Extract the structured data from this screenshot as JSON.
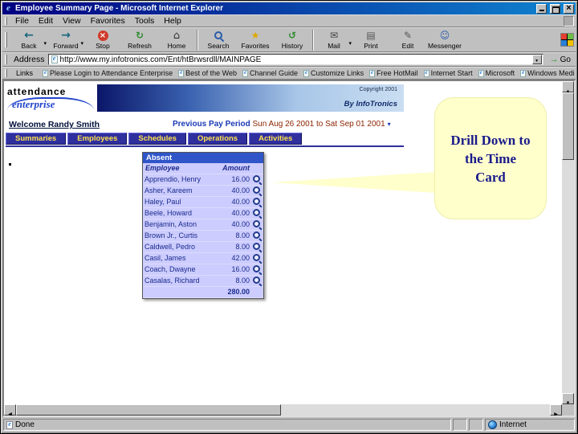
{
  "window": {
    "title": "Employee Summary Page - Microsoft Internet Explorer"
  },
  "menubar": {
    "items": [
      "File",
      "Edit",
      "View",
      "Favorites",
      "Tools",
      "Help"
    ]
  },
  "toolbar": {
    "buttons": [
      {
        "label": "Back",
        "icon": "back-icon",
        "has_menu": true
      },
      {
        "label": "Forward",
        "icon": "forward-icon",
        "has_menu": true
      },
      {
        "label": "Stop",
        "icon": "stop-icon"
      },
      {
        "label": "Refresh",
        "icon": "refresh-icon"
      },
      {
        "label": "Home",
        "icon": "home-icon",
        "sep_after": true
      },
      {
        "label": "Search",
        "icon": "search-icon"
      },
      {
        "label": "Favorites",
        "icon": "favorites-icon"
      },
      {
        "label": "History",
        "icon": "history-icon",
        "sep_after": true
      },
      {
        "label": "Mail",
        "icon": "mail-icon",
        "has_menu": true
      },
      {
        "label": "Print",
        "icon": "print-icon"
      },
      {
        "label": "Edit",
        "icon": "edit-icon"
      },
      {
        "label": "Messenger",
        "icon": "messenger-icon"
      }
    ]
  },
  "addressbar": {
    "label": "Address",
    "value": "http://www.my.infotronics.com/Ent/htBrwsrdll/MAINPAGE",
    "go_label": "Go"
  },
  "linksbar": {
    "label": "Links",
    "items": [
      "Please Login to Attendance Enterprise",
      "Best of the Web",
      "Channel Guide",
      "Customize Links",
      "Free HotMail",
      "Internet Start",
      "Microsoft",
      "Windows Media"
    ]
  },
  "page": {
    "logo_line1": "attendance",
    "logo_line2": "enterprise",
    "copyright": "Copyright 2001",
    "byline": "By InfoTronics",
    "welcome": "Welcome Randy Smith",
    "pay_period_label": "Previous Pay Period",
    "pay_period_dates": "Sun Aug 26 2001 to Sat Sep 01 2001",
    "tabs": [
      "Summaries",
      "Employees",
      "Schedules",
      "Operations",
      "Activities"
    ],
    "panel": {
      "title": "Absent",
      "columns": [
        "Employee",
        "Amount"
      ],
      "rows": [
        {
          "name": "Apprendio, Henry",
          "amount": "16.00"
        },
        {
          "name": "Asher, Kareem",
          "amount": "40.00"
        },
        {
          "name": "Haley, Paul",
          "amount": "40.00"
        },
        {
          "name": "Beele, Howard",
          "amount": "40.00"
        },
        {
          "name": "Benjamin, Aston",
          "amount": "40.00"
        },
        {
          "name": "Brown Jr., Curtis",
          "amount": "8.00"
        },
        {
          "name": "Caldwell, Pedro",
          "amount": "8.00"
        },
        {
          "name": "Casil, James",
          "amount": "42.00"
        },
        {
          "name": "Coach, Dwayne",
          "amount": "16.00"
        },
        {
          "name": "Casalas, Richard",
          "amount": "8.00"
        }
      ],
      "total": "280.00"
    }
  },
  "callout": {
    "text": "Drill Down to the Time Card"
  },
  "statusbar": {
    "left": "Done",
    "right": "Internet"
  },
  "colors": {
    "title_gradient_start": "#000080",
    "title_gradient_end": "#1084d0",
    "chrome": "#c0c0c0",
    "tab_bg": "#2f2f9e",
    "tab_text": "#ffe14d",
    "panel_header_bg": "#2f55c8",
    "panel_row_bg": "#ccccfe",
    "callout_bg": "#ffffcc",
    "callout_text": "#1a1a8c"
  }
}
